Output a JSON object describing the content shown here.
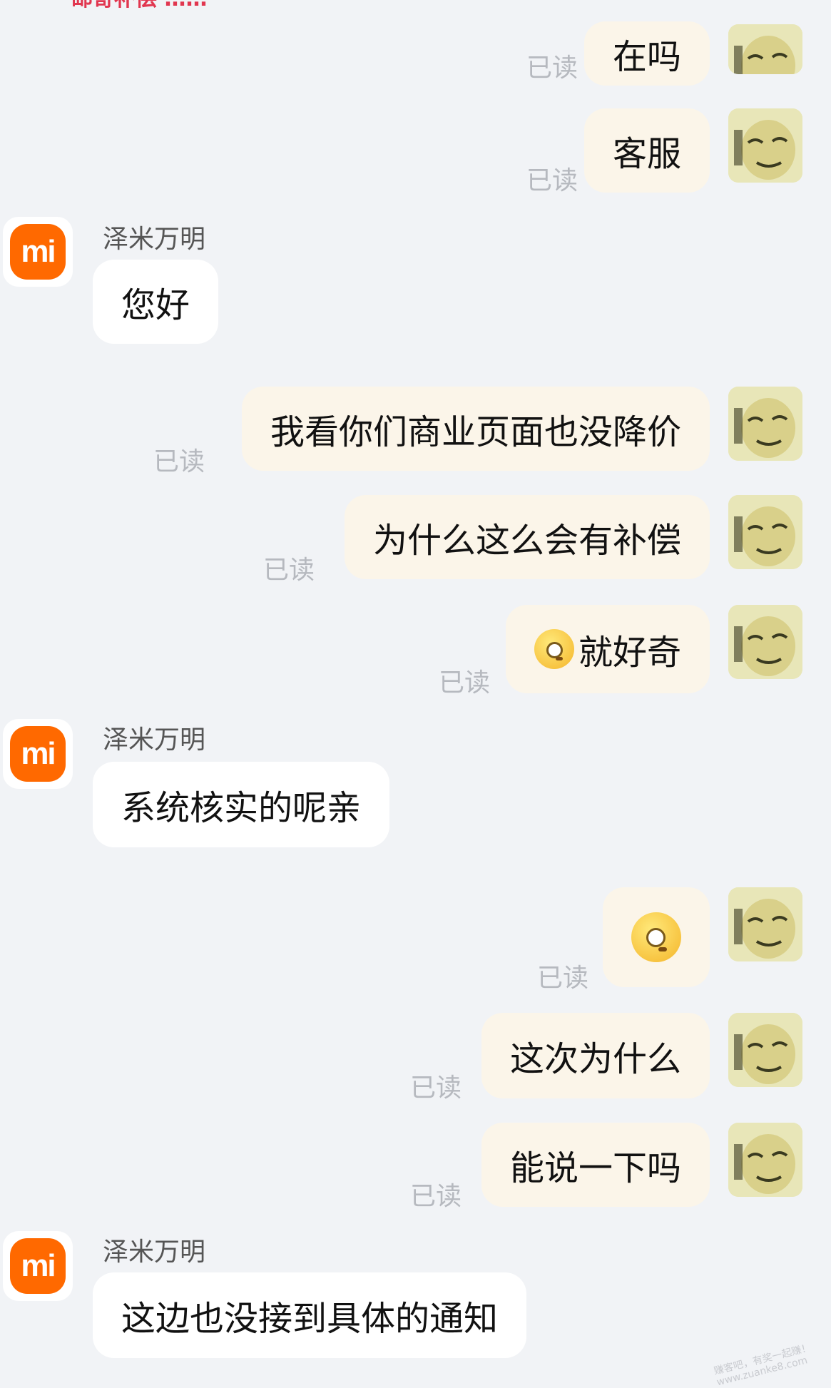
{
  "top_partial_text": "邮寄补偿 ……",
  "read_label": "已读",
  "sender_name": "泽米万明",
  "mi_logo_text": "mi",
  "messages": [
    {
      "dir": "out",
      "text": "在吗"
    },
    {
      "dir": "out",
      "text": "客服"
    },
    {
      "dir": "in",
      "text": "您好"
    },
    {
      "dir": "out",
      "text": "我看你们商业页面也没降价"
    },
    {
      "dir": "out",
      "text": "为什么这么会有补偿"
    },
    {
      "dir": "out",
      "text": "就好奇",
      "emoji": "monocle-face-icon"
    },
    {
      "dir": "in",
      "text": "系统核实的呢亲"
    },
    {
      "dir": "out",
      "text": "",
      "emoji": "monocle-face-icon"
    },
    {
      "dir": "out",
      "text": "这次为什么"
    },
    {
      "dir": "out",
      "text": "能说一下吗"
    },
    {
      "dir": "in",
      "text": "这边也没接到具体的通知"
    }
  ],
  "watermark": [
    "赚客吧，有奖一起赚！",
    "www.zuanke8.com"
  ],
  "colors": {
    "out_bubble": "#fbf5e9",
    "in_bubble": "#ffffff",
    "mi_orange": "#ff6900",
    "background": "#f1f3f6"
  }
}
